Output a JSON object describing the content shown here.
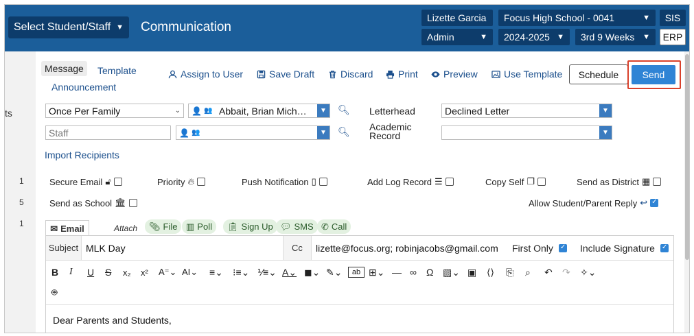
{
  "header": {
    "select_label": "Select Student/Staff",
    "title": "Communication",
    "user": "Lizette Garcia",
    "school": "Focus High School - 0041",
    "role": "Admin",
    "year": "2024-2025",
    "term": "3rd 9 Weeks",
    "sis": "SIS",
    "erp": "ERP"
  },
  "leftstrip": {
    "ts": "ts",
    "n1": "1",
    "n2": "5",
    "n3": "1"
  },
  "tabs": {
    "message": "Message",
    "template": "Template",
    "announcement": "Announcement"
  },
  "toolbar": {
    "assign": "Assign to User",
    "save_draft": "Save Draft",
    "discard": "Discard",
    "print": "Print",
    "preview": "Preview",
    "use_template": "Use Template",
    "schedule": "Schedule",
    "send": "Send"
  },
  "form": {
    "once_per_family": "Once Per Family",
    "recipients_value": "Abbait, Brian Mich…",
    "staff_placeholder": "Staff",
    "letterhead_label": "Letterhead",
    "letterhead_value": "Declined Letter",
    "academic_label": "Academic Record",
    "import_recipients": "Import Recipients"
  },
  "options": {
    "secure_email": "Secure Email",
    "priority": "Priority",
    "push_notification": "Push Notification",
    "add_log_record": "Add Log Record",
    "copy_self": "Copy Self",
    "send_as_district": "Send as District",
    "send_as_school": "Send as School",
    "allow_reply": "Allow Student/Parent Reply"
  },
  "compose": {
    "email_tab": "Email",
    "attach": "Attach",
    "file": "File",
    "poll": "Poll",
    "signup": "Sign Up",
    "sms": "SMS",
    "call": "Call",
    "subject_label": "Subject",
    "subject_value": "MLK Day",
    "cc_label": "Cc",
    "cc_value": "lizette@focus.org; robinjacobs@gmail.com",
    "first_only": "First Only",
    "include_signature": "Include Signature",
    "body": "Dear Parents and Students,"
  },
  "colors": {
    "header": "#1b5e9a",
    "header_box": "#0d3c6b",
    "send": "#2f84d5",
    "highlight": "#d9412b",
    "link": "#1b4f8c"
  }
}
